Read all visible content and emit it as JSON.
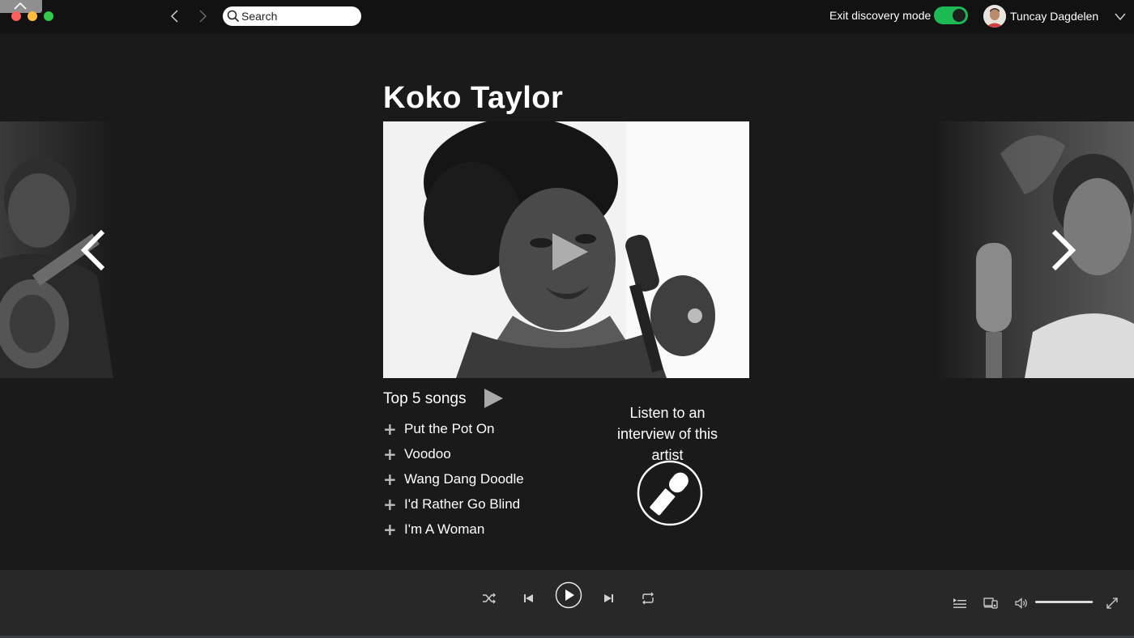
{
  "window": {
    "search_placeholder": "Search"
  },
  "header": {
    "exit_discovery_label": "Exit discovery mode",
    "discovery_toggle_on": true,
    "username": "Tuncay Dagdelen"
  },
  "artist": {
    "name": "Koko Taylor",
    "top_songs_label": "Top 5 songs",
    "songs": [
      "Put the Pot On",
      "Voodoo",
      "Wang Dang Doodle",
      "I'd Rather Go Blind",
      "I'm A Woman"
    ],
    "interview_text": "Listen to an interview of this artist"
  },
  "player": {
    "volume_level": 0.98
  },
  "colors": {
    "accent_green": "#1db954",
    "background": "#1a1a1a",
    "topbar": "#121212",
    "player_bar": "#282828"
  },
  "icons": {
    "corner": "chevron-up-icon",
    "back": "chevron-left-icon",
    "forward": "chevron-right-icon",
    "search": "search-icon",
    "user_menu": "chevron-down-icon",
    "carousel_prev": "chevron-left-icon",
    "carousel_next": "chevron-right-icon",
    "video": "play-icon",
    "songs_play": "play-icon",
    "add": "plus-icon",
    "interview": "microphone-icon",
    "shuffle": "shuffle-icon",
    "previous": "skip-back-icon",
    "play": "play-circle-icon",
    "next": "skip-forward-icon",
    "repeat": "repeat-icon",
    "queue": "queue-icon",
    "devices": "devices-icon",
    "volume": "volume-icon",
    "fullscreen": "fullscreen-icon"
  }
}
